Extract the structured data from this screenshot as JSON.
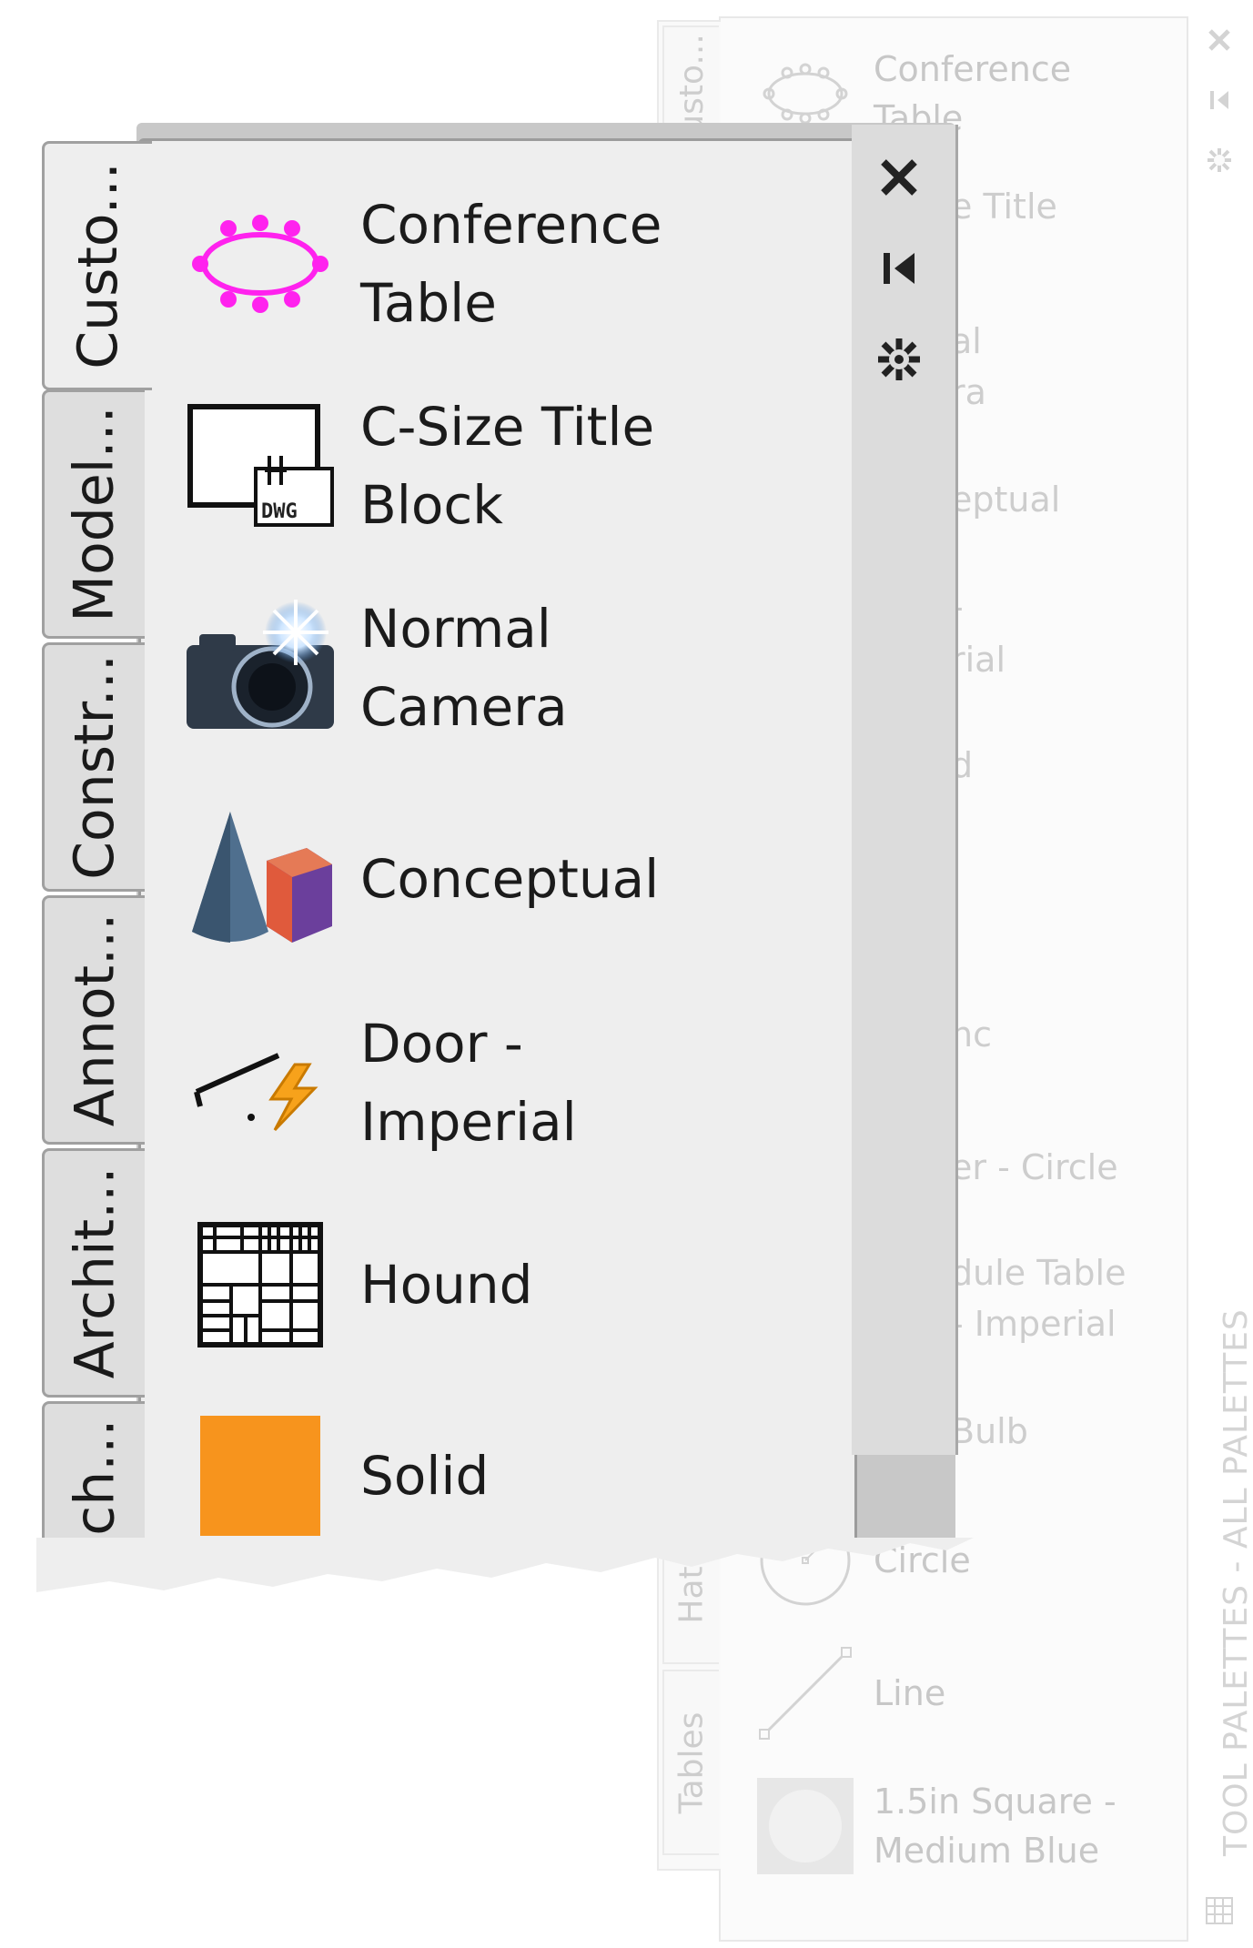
{
  "background_palette": {
    "title": "TOOL PALETTES - ALL PALETTES",
    "tabs": [
      {
        "label": "Custo..."
      },
      {
        "label": "Hatch..."
      },
      {
        "label": "Tables"
      }
    ],
    "items": [
      {
        "label": "Conference Table",
        "icon": "conference-table-icon"
      },
      {
        "label": "Circle",
        "icon": "circle-icon"
      },
      {
        "label": "Line",
        "icon": "line-icon"
      },
      {
        "label": "1.5in Square - Medium Blue",
        "icon": "material-swatch-icon"
      }
    ],
    "partial_labels": [
      {
        "text": "e Title"
      },
      {
        "text": "al"
      },
      {
        "text": "ra"
      },
      {
        "text": "eptual"
      },
      {
        "text": "-"
      },
      {
        "text": "rial"
      },
      {
        "text": "d"
      },
      {
        "text": "nc"
      },
      {
        "text": "er - Circle"
      },
      {
        "text": "dule Table"
      },
      {
        "text": "- Imperial"
      },
      {
        "text": "Bulb"
      }
    ],
    "controls": [
      {
        "icon": "close-icon"
      },
      {
        "icon": "auto-hide-icon"
      },
      {
        "icon": "properties-icon"
      },
      {
        "icon": "palette-grid-icon"
      }
    ]
  },
  "main_palette": {
    "tabs": [
      {
        "label": "Custo...",
        "active": true
      },
      {
        "label": "Model...",
        "active": false
      },
      {
        "label": "Constr...",
        "active": false
      },
      {
        "label": "Annot...",
        "active": false
      },
      {
        "label": "Archit...",
        "active": false
      },
      {
        "label": "Mech...",
        "active": false
      }
    ],
    "items": [
      {
        "label": "Conference Table",
        "icon": "conference-table-icon",
        "color": "#ff22ee"
      },
      {
        "label": "C-Size Title Block",
        "icon": "title-block-dwg-icon"
      },
      {
        "label": "Normal Camera",
        "icon": "camera-icon"
      },
      {
        "label": "Conceptual",
        "icon": "visual-style-cone-box-icon"
      },
      {
        "label": "Door - Imperial",
        "icon": "door-block-icon"
      },
      {
        "label": "Hound",
        "icon": "hatch-pattern-icon"
      },
      {
        "label": "Solid",
        "icon": "solid-fill-icon",
        "color": "#f7941d"
      }
    ],
    "controls": [
      {
        "icon": "close-icon"
      },
      {
        "icon": "auto-hide-icon"
      },
      {
        "icon": "properties-icon"
      }
    ]
  }
}
